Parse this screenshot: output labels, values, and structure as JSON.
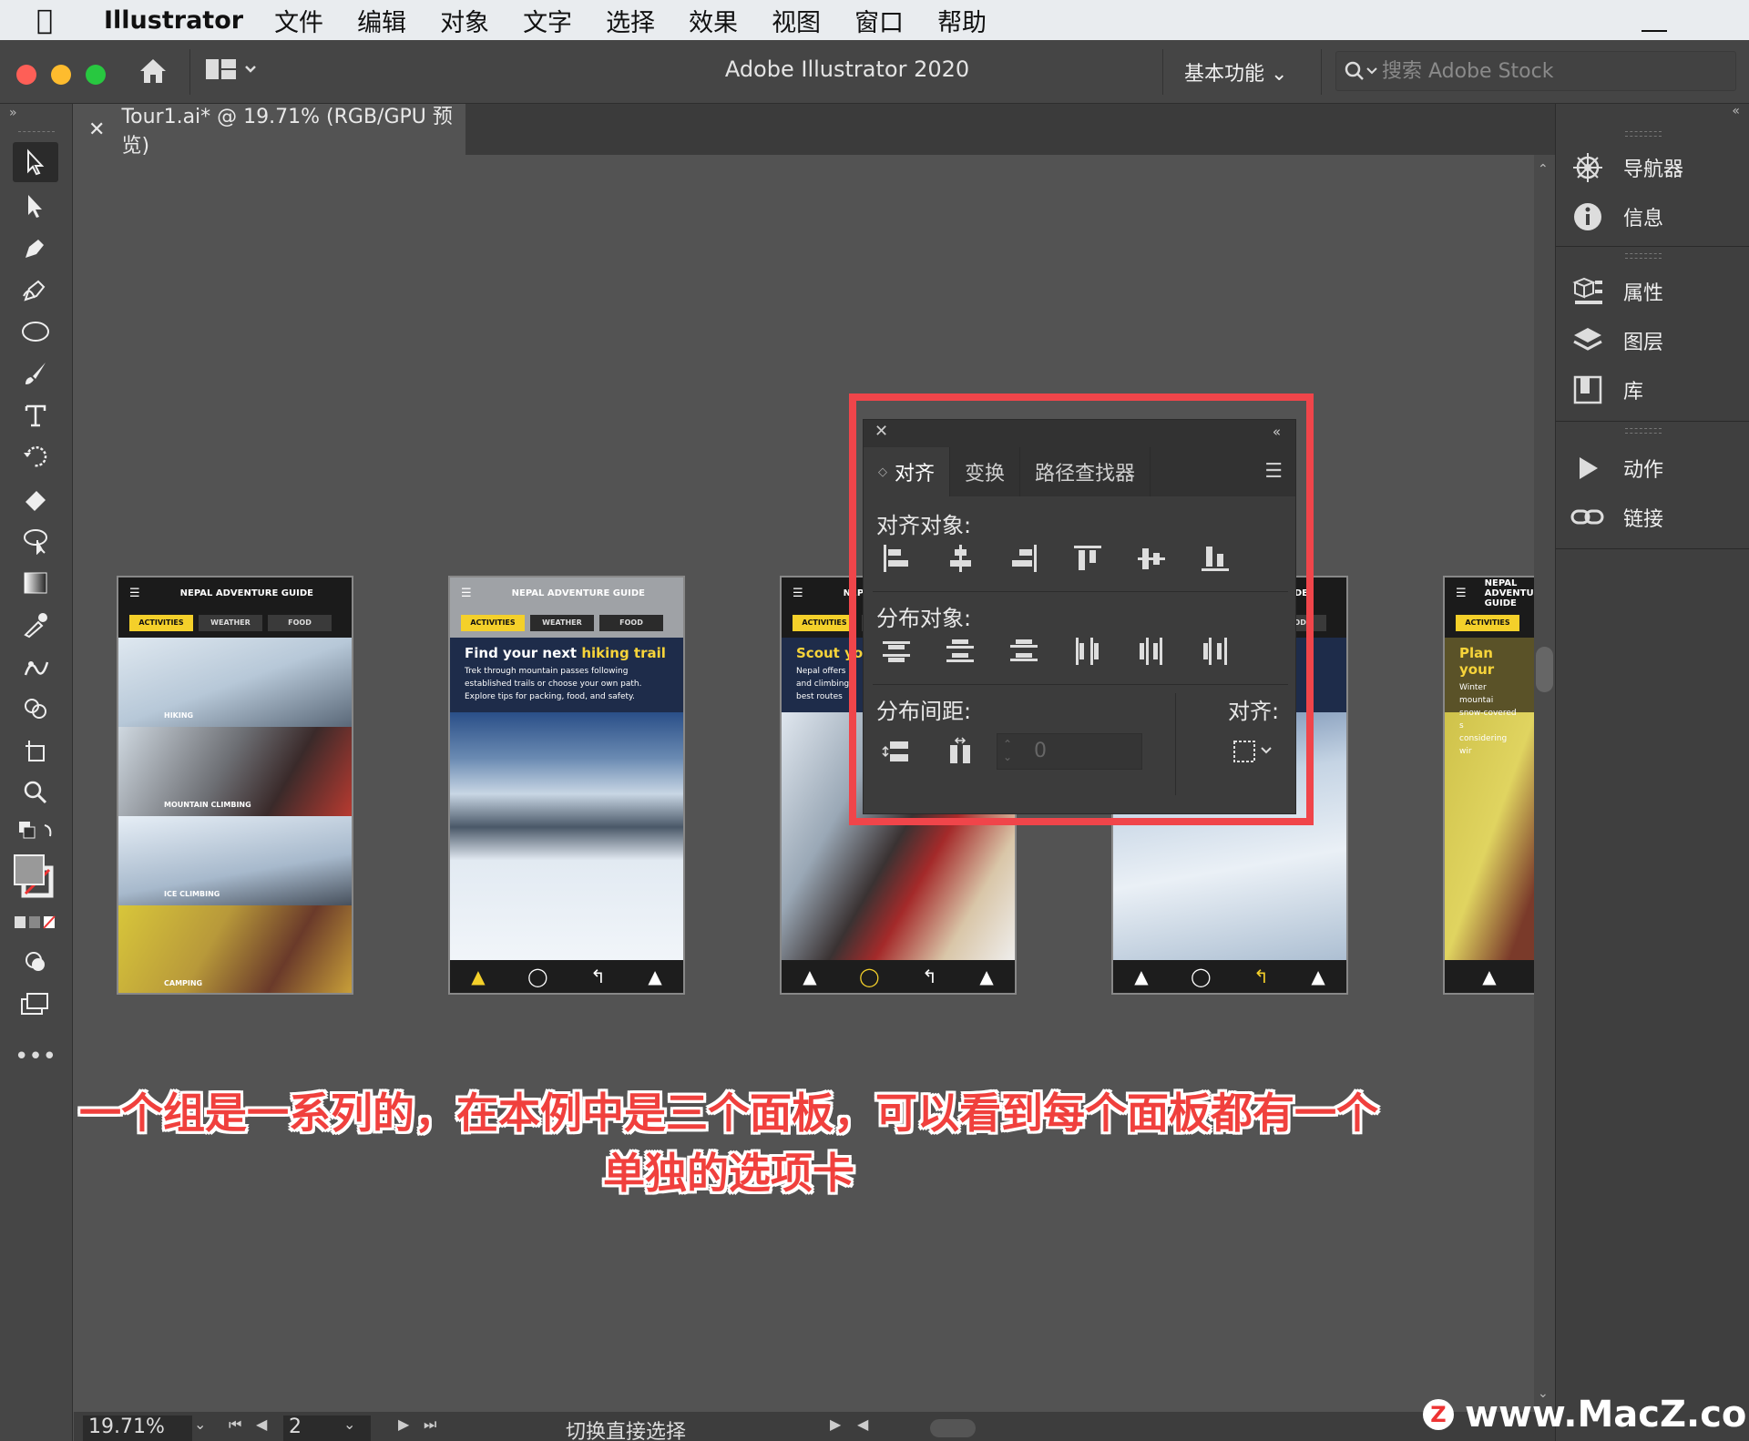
{
  "menubar": {
    "app_name": "Illustrator",
    "items": [
      "文件",
      "编辑",
      "对象",
      "文字",
      "选择",
      "效果",
      "视图",
      "窗口",
      "帮助"
    ]
  },
  "appbar": {
    "title": "Adobe Illustrator 2020",
    "workspace": "基本功能",
    "search_placeholder": "搜索 Adobe Stock"
  },
  "document_tab": {
    "label": "Tour1.ai* @ 19.71% (RGB/GPU 预览)"
  },
  "artboards": {
    "header": "NEPAL ADVENTURE GUIDE",
    "tabs": [
      "ACTIVITIES",
      "WEATHER",
      "FOOD"
    ],
    "board1_labels": [
      "HIKING",
      "MOUNTAIN CLIMBING",
      "ICE CLIMBING",
      "CAMPING"
    ],
    "board2": {
      "heading_prefix": "Find your next ",
      "heading_highlight": "hiking trail",
      "body": "Trek through mountain passes following established trails or choose your own path. Explore tips for packing, food, and safety."
    },
    "board3": {
      "heading": "Scout yo",
      "body": "Nepal offers\nand climbing\nbest routes"
    },
    "board5": {
      "heading": "Plan your",
      "body": "Winter mountai\nsnow-covered s\nconsidering wir"
    }
  },
  "align_panel": {
    "tabs": [
      "对齐",
      "变换",
      "路径查找器"
    ],
    "align_objects_label": "对齐对象:",
    "distribute_objects_label": "分布对象:",
    "distribute_spacing_label": "分布间距:",
    "align_to_label": "对齐:",
    "spacing_value": "0"
  },
  "right_dock": {
    "items": [
      "导航器",
      "信息",
      "属性",
      "图层",
      "库",
      "动作",
      "链接"
    ]
  },
  "statusbar": {
    "zoom": "19.71%",
    "page": "2",
    "mode": "切换直接选择"
  },
  "caption": "一个组是一系列的，在本例中是三个面板，可以看到每个面板都有一个单独的选项卡",
  "watermark": "www.MacZ.com",
  "colors": {
    "highlight_box": "#f0454a",
    "accent_yellow": "#f4d02a"
  }
}
